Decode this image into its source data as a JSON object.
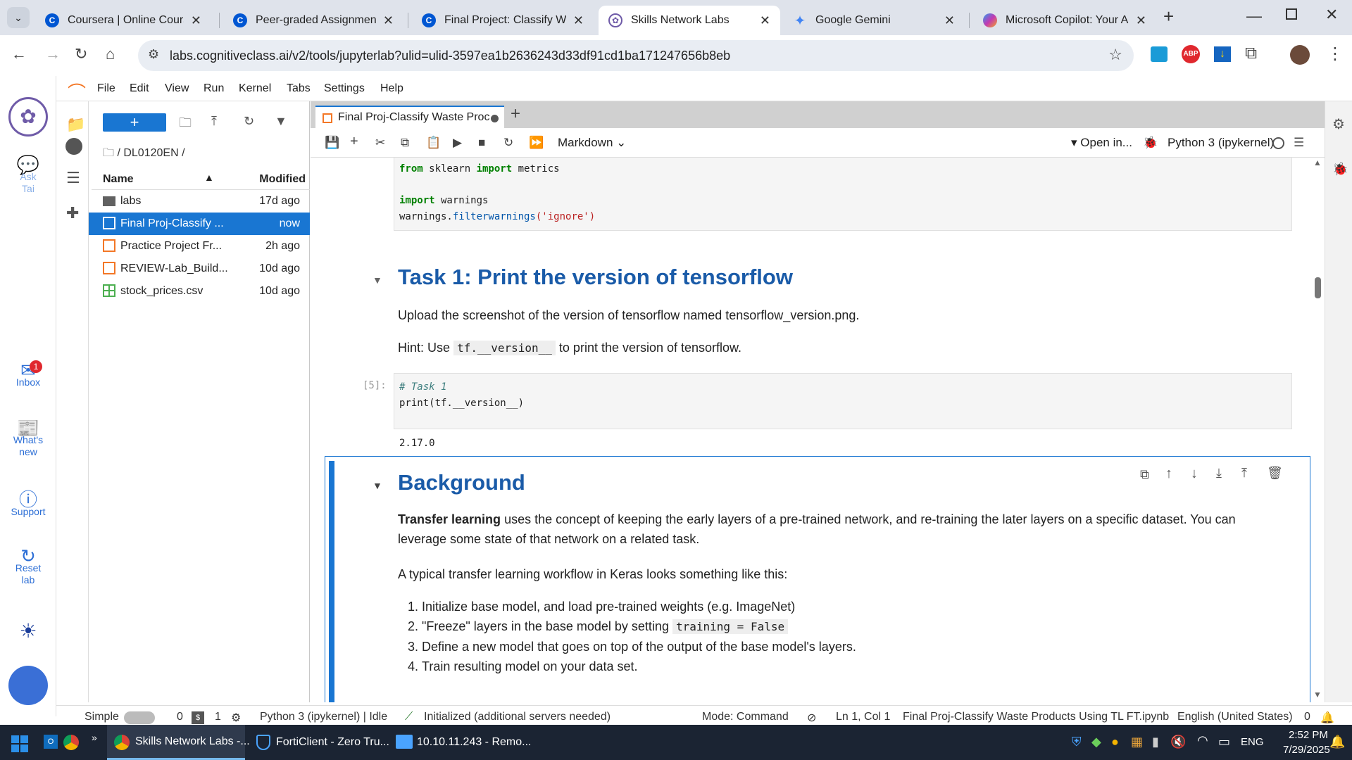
{
  "browser": {
    "tabs": [
      {
        "title": "Coursera | Online Courses &",
        "icon": "coursera-icon",
        "color": "#0056d2"
      },
      {
        "title": "Peer-graded Assignment: Cl",
        "icon": "coursera-icon",
        "color": "#0056d2"
      },
      {
        "title": "Final Project: Classify Waste",
        "icon": "coursera-icon",
        "color": "#0056d2"
      },
      {
        "title": "Skills Network Labs",
        "icon": "skills-network-icon",
        "color": "#6f5ba8"
      },
      {
        "title": "Google Gemini",
        "icon": "gemini-icon",
        "color": "#4285f4"
      },
      {
        "title": "Microsoft Copilot: Your AI c",
        "icon": "copilot-icon",
        "color": "#c239b3"
      }
    ],
    "url": "labs.cognitiveclass.ai/v2/tools/jupyterlab?ulid=ulid-3597ea1b2636243d33df91cd1ba171247656b8eb"
  },
  "menu": [
    "File",
    "Edit",
    "View",
    "Run",
    "Kernel",
    "Tabs",
    "Settings",
    "Help"
  ],
  "rail": {
    "ask": "Ask Tai",
    "inbox": "Inbox",
    "inbox_badge": "1",
    "whats_new": "What's new",
    "support": "Support",
    "reset": "Reset lab"
  },
  "filebrowser": {
    "breadcrumb": "/ DL0120EN /",
    "col_name": "Name",
    "col_modified": "Modified",
    "files": [
      {
        "name": "labs",
        "modified": "17d ago",
        "type": "folder"
      },
      {
        "name": "Final Proj-Classify ...",
        "modified": "now",
        "type": "notebook"
      },
      {
        "name": "Practice Project Fr...",
        "modified": "2h ago",
        "type": "notebook"
      },
      {
        "name": "REVIEW-Lab_Build...",
        "modified": "10d ago",
        "type": "notebook"
      },
      {
        "name": "stock_prices.csv",
        "modified": "10d ago",
        "type": "csv"
      }
    ]
  },
  "notebook": {
    "tab_title": "Final Proj-Classify Waste Proc",
    "cell_type": "Markdown",
    "open_in": "Open in...",
    "kernel": "Python 3 (ipykernel)",
    "code_top": {
      "line1_kw": "from",
      "line1_mod": " sklearn ",
      "line1_kw2": "import",
      "line1_rest": " metrics",
      "line2_kw": "import",
      "line2_rest": " warnings",
      "line3_obj": "warnings.",
      "line3_fn": "filterwarnings",
      "line3_str": "('ignore')"
    },
    "task1_heading": "Task 1: Print the version of tensorflow",
    "task1_text": "Upload the screenshot of the version of tensorflow named tensorflow_version.png.",
    "hint_prefix": "Hint: Use",
    "hint_code": "tf.__version__",
    "hint_suffix": "to print the version of tensorflow.",
    "cell_prompt": "[5]:",
    "cell_comment": "# Task 1",
    "cell_code": "print(tf.__version__)",
    "output": "2.17.0",
    "bg_heading": "Background",
    "bg_bold": "Transfer learning",
    "bg_text": " uses the concept of keeping the early layers of a pre-trained network, and re-training the later layers on a specific dataset. You can leverage some state of that network on a related task.",
    "workflow_intro": "A typical transfer learning workflow in Keras looks something like this:",
    "steps": [
      "Initialize base model, and load pre-trained weights (e.g. ImageNet)",
      "\"Freeze\" layers in the base model by setting",
      "Define a new model that goes on top of the output of the base model's layers.",
      "Train resulting model on your data set."
    ],
    "step2_code": "training = False"
  },
  "status": {
    "mode_label": "Simple",
    "zero": "0",
    "one": "1",
    "kernel_status": "Python 3 (ipykernel) | Idle",
    "initialized": "Initialized (additional servers needed)",
    "mode": "Mode: Command",
    "position": "Ln 1, Col 1",
    "filename": "Final Proj-Classify Waste Products Using TL FT.ipynb",
    "language": "English (United States)",
    "notifications": "0"
  },
  "taskbar": {
    "tasks": [
      "Skills Network Labs -...",
      "FortiClient - Zero Tru...",
      "10.10.11.243 - Remo..."
    ],
    "lang": "ENG",
    "time": "2:52 PM",
    "date": "7/29/2025"
  }
}
